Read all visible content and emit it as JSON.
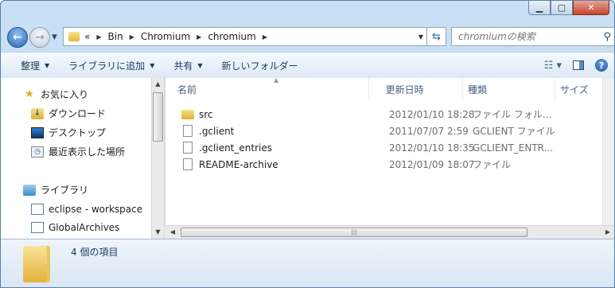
{
  "window": {
    "caption_buttons": [
      "minimize",
      "maximize",
      "close"
    ]
  },
  "address": {
    "overflow": "«",
    "crumbs": [
      "Bin",
      "Chromium",
      "chromium"
    ]
  },
  "search": {
    "placeholder": "chromiumの検索"
  },
  "toolbar": {
    "organize": "整理",
    "add_to_library": "ライブラリに追加",
    "share": "共有",
    "new_folder": "新しいフォルダー"
  },
  "nav": {
    "favorites": "お気に入り",
    "downloads": "ダウンロード",
    "desktop": "デスクトップ",
    "recent": "最近表示した場所",
    "libraries": "ライブラリ",
    "lib1": "eclipse - workspace",
    "lib2": "GlobalArchives"
  },
  "columns": {
    "name": "名前",
    "date": "更新日時",
    "type": "種類",
    "size": "サイズ"
  },
  "files": [
    {
      "name": "src",
      "date": "2012/01/10 18:28",
      "type": "ファイル フォル...",
      "kind": "folder"
    },
    {
      "name": ".gclient",
      "date": "2011/07/07 2:59",
      "type": "GCLIENT ファイル",
      "kind": "file"
    },
    {
      "name": ".gclient_entries",
      "date": "2012/01/10 18:35",
      "type": "GCLIENT_ENTR...",
      "kind": "file"
    },
    {
      "name": "README-archive",
      "date": "2012/01/09 18:07",
      "type": "ファイル",
      "kind": "file"
    }
  ],
  "status": {
    "count_text": "4 個の項目"
  }
}
